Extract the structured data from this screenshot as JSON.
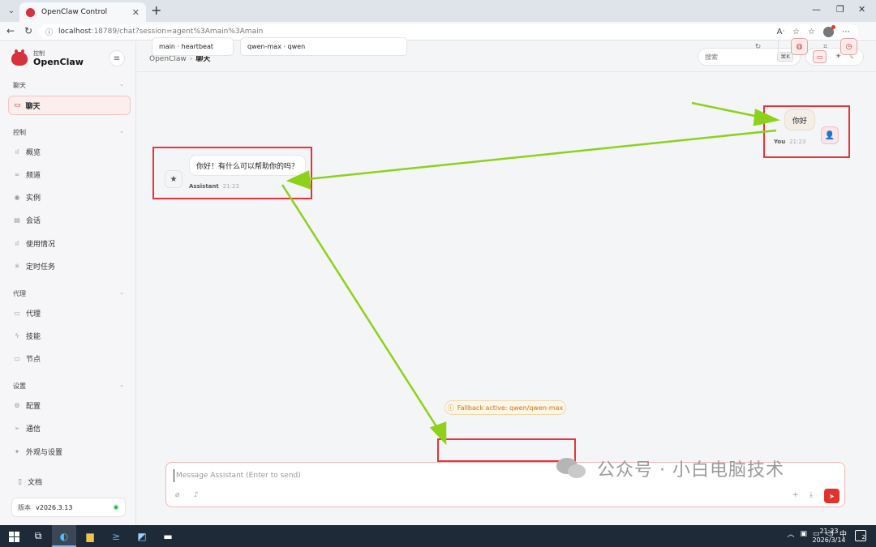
{
  "browser": {
    "tab_title": "OpenClaw Control",
    "url_host": "localhost",
    "url_rest": ":18789/chat?session=agent%3Amain%3Amain"
  },
  "sidebar": {
    "brand_sub": "控制",
    "brand_name": "OpenClaw",
    "sections": [
      {
        "label": "聊天",
        "items": [
          {
            "label": "聊天",
            "icon": "chat-icon",
            "active": true
          }
        ]
      },
      {
        "label": "控制",
        "items": [
          {
            "label": "概览",
            "icon": "bar-chart-icon"
          },
          {
            "label": "频道",
            "icon": "link-icon"
          },
          {
            "label": "实例",
            "icon": "broadcast-icon"
          },
          {
            "label": "会话",
            "icon": "document-icon"
          },
          {
            "label": "使用情况",
            "icon": "bar-chart-icon"
          },
          {
            "label": "定时任务",
            "icon": "spinner-icon"
          }
        ]
      },
      {
        "label": "代理",
        "items": [
          {
            "label": "代理",
            "icon": "folder-icon"
          },
          {
            "label": "技能",
            "icon": "lightning-icon"
          },
          {
            "label": "节点",
            "icon": "monitor-icon"
          }
        ]
      },
      {
        "label": "设置",
        "items": [
          {
            "label": "配置",
            "icon": "gear-icon"
          },
          {
            "label": "通信",
            "icon": "send-icon"
          },
          {
            "label": "外观与设置",
            "icon": "sparkle-icon"
          }
        ]
      }
    ],
    "docs_label": "文档",
    "version_label": "版本",
    "version_value": "v2026.3.13",
    "status_color": "#27b34a"
  },
  "topbar": {
    "breadcrumb_root": "OpenClaw",
    "breadcrumb_current": "聊天",
    "search_placeholder": "搜索",
    "search_shortcut": "⌘K"
  },
  "chat": {
    "session_chip": "main · heartbeat",
    "model_chip": "qwen-max · qwen",
    "messages": [
      {
        "role": "user",
        "text": "你好",
        "sender": "You",
        "time": "21:23"
      },
      {
        "role": "assistant",
        "text": "你好！有什么可以帮助你的吗？",
        "sender": "Assistant",
        "time": "21:23"
      }
    ],
    "fallback_notice": "Fallback active: qwen/qwen-max",
    "composer_placeholder": "Message Assistant (Enter to send)"
  },
  "watermark": "公众号 · 小白电脑技术",
  "taskbar": {
    "time": "21:23",
    "date": "2026/3/14",
    "ime": "中",
    "notification_count": "2"
  },
  "colors": {
    "accent": "#d6313c",
    "highlight_box": "#e8333a",
    "annotation_arrow": "#8dd11a",
    "fallback_text": "#c27a10"
  }
}
